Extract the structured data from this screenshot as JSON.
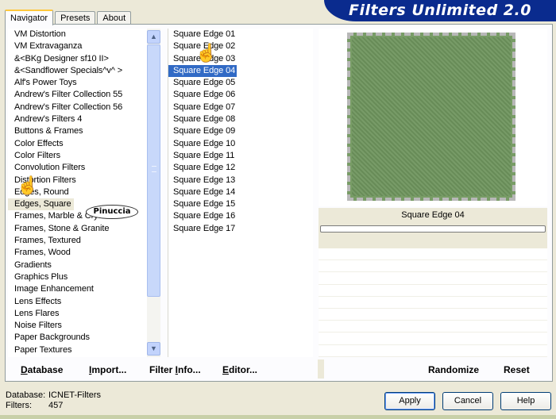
{
  "tabs": [
    {
      "label": "Navigator"
    },
    {
      "label": "Presets"
    },
    {
      "label": "About"
    }
  ],
  "title": "Filters Unlimited 2.0",
  "categories": [
    "VM Distortion",
    "VM Extravaganza",
    "&<BKg Designer sf10 II>",
    "&<Sandflower Specials^v^ >",
    "Alf's Power Toys",
    "Andrew's Filter Collection 55",
    "Andrew's Filter Collection 56",
    "Andrew's Filters 4",
    "Buttons & Frames",
    "Color Effects",
    "Color Filters",
    "Convolution Filters",
    "Distortion Filters",
    "Edges, Round",
    "Edges, Square",
    "Frames, Marble & Crystal",
    "Frames, Stone & Granite",
    "Frames, Textured",
    "Frames, Wood",
    "Gradients",
    "Graphics Plus",
    "Image Enhancement",
    "Lens Effects",
    "Lens Flares",
    "Noise Filters",
    "Paper Backgrounds",
    "Paper Textures"
  ],
  "selected_category": "Edges, Square",
  "filters": [
    "Square Edge 01",
    "Square Edge 02",
    "Square Edge 03",
    "Square Edge 04",
    "Square Edge 05",
    "Square Edge 06",
    "Square Edge 07",
    "Square Edge 08",
    "Square Edge 09",
    "Square Edge 10",
    "Square Edge 11",
    "Square Edge 12",
    "Square Edge 13",
    "Square Edge 14",
    "Square Edge 15",
    "Square Edge 16",
    "Square Edge 17"
  ],
  "selected_filter": "Square Edge 04",
  "preview": {
    "filter_name": "Square Edge 04"
  },
  "actions": {
    "database": "Database",
    "import": "Import...",
    "filter_info": "Filter Info...",
    "editor": "Editor...",
    "randomize": "Randomize",
    "reset": "Reset"
  },
  "footer": {
    "database_label": "Database:",
    "database_value": "ICNET-Filters",
    "filters_label": "Filters:",
    "filters_value": "457"
  },
  "buttons": {
    "apply": "Apply",
    "cancel": "Cancel",
    "help": "Help"
  },
  "watermark": "Pinuccia",
  "colors": {
    "title_bar": "#0a2b8e",
    "selection": "#316ac5",
    "preview_green": "#789c66"
  }
}
